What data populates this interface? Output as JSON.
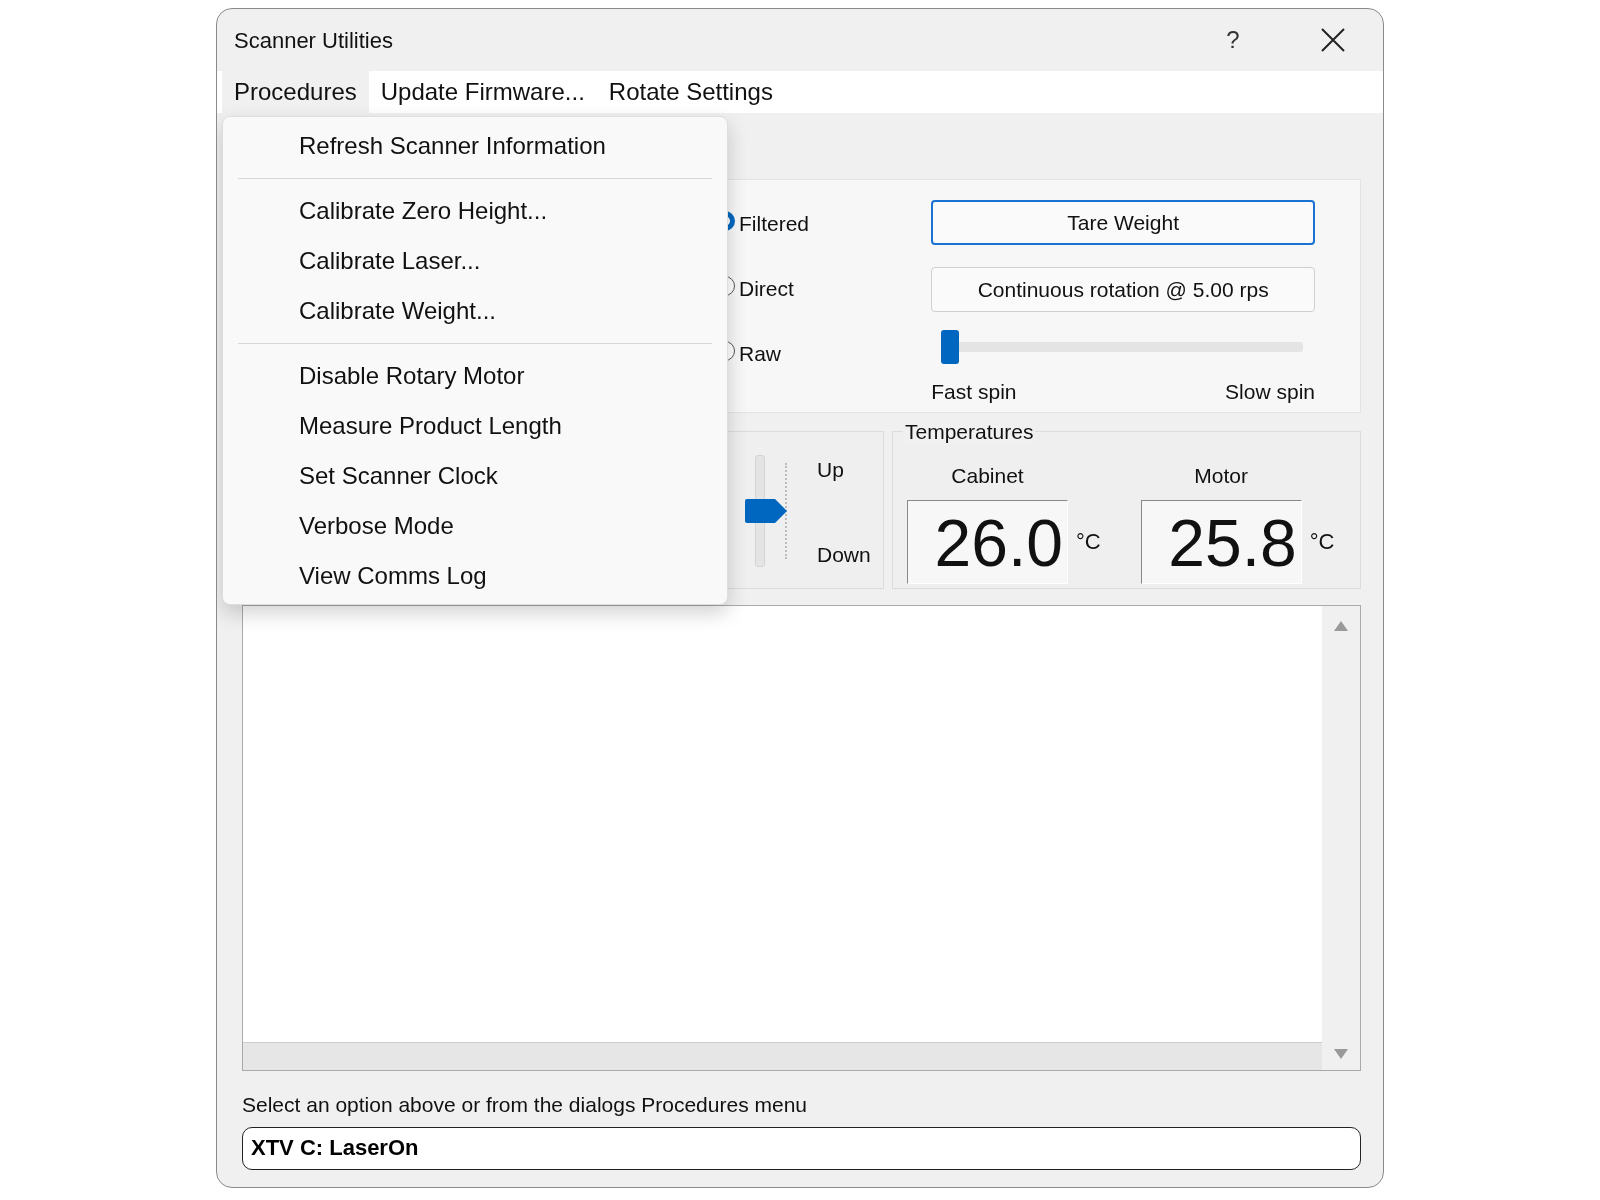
{
  "window": {
    "title": "Scanner Utilities",
    "help": "?"
  },
  "menubar": [
    {
      "label": "Procedures",
      "selected": true
    },
    {
      "label": "Update Firmware...",
      "selected": false
    },
    {
      "label": "Rotate Settings",
      "selected": false
    }
  ],
  "menu": [
    {
      "kind": "item",
      "label": "Refresh Scanner Information"
    },
    {
      "kind": "separator"
    },
    {
      "kind": "item",
      "label": "Calibrate Zero Height..."
    },
    {
      "kind": "item",
      "label": "Calibrate Laser..."
    },
    {
      "kind": "item",
      "label": "Calibrate Weight..."
    },
    {
      "kind": "separator"
    },
    {
      "kind": "item",
      "label": "Disable Rotary Motor"
    },
    {
      "kind": "item",
      "label": "Measure Product Length"
    },
    {
      "kind": "item",
      "label": "Set Scanner Clock"
    },
    {
      "kind": "item",
      "label": "Verbose Mode"
    },
    {
      "kind": "item",
      "label": "View Comms Log"
    }
  ],
  "readout_modes": [
    {
      "label": "Filtered",
      "selected": true
    },
    {
      "label": "Direct",
      "selected": false
    },
    {
      "label": "Raw",
      "selected": false
    }
  ],
  "buttons": [
    {
      "label": "Tare Weight",
      "focused": true
    },
    {
      "label": "Continuous rotation @ 5.00 rps",
      "focused": false
    }
  ],
  "speed_slider": {
    "level": 0,
    "min_label": "Fast spin",
    "max_label": "Slow spin"
  },
  "height_slider": {
    "level": 0.5,
    "top_label": "Up",
    "bottom_label": "Down"
  },
  "temperatures": {
    "title": "Temperatures",
    "sensors": [
      {
        "name": "Cabinet",
        "value": "26.0",
        "unit": "°C"
      },
      {
        "name": "Motor",
        "value": "25.8",
        "unit": "°C"
      }
    ]
  },
  "status_text": "Select an option above or from the dialogs Procedures menu",
  "command_field": {
    "value": "XTV C: LaserOn"
  }
}
